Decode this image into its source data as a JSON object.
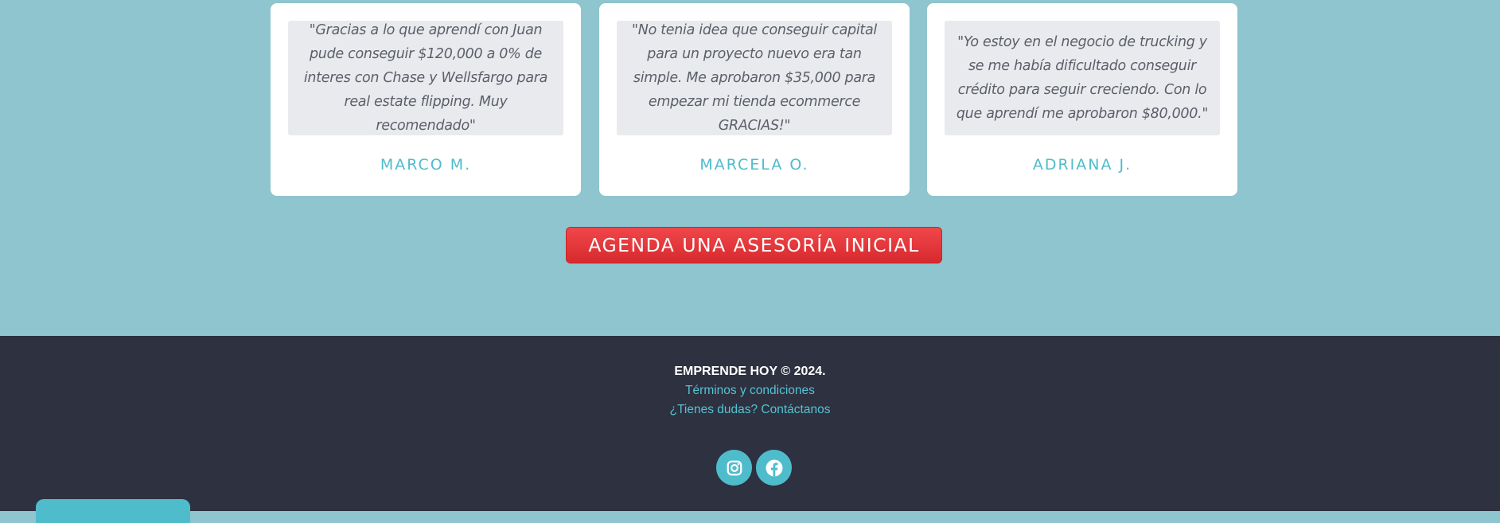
{
  "testimonials": [
    {
      "quote": "\"Gracias a lo que aprendí con Juan pude conseguir $120,000 a 0% de interes con Chase y Wellsfargo para real estate flipping. Muy recomendado\"",
      "author": "MARCO M."
    },
    {
      "quote": "\"No tenia idea que conseguir capital para un proyecto nuevo era tan simple. Me aprobaron $35,000 para empezar mi tienda ecommerce GRACIAS!\"",
      "author": "MARCELA O."
    },
    {
      "quote": "\"Yo estoy en el negocio de trucking y se me había dificultado conseguir crédito para seguir creciendo. Con lo que aprendí me aprobaron $80,000.\"",
      "author": "ADRIANA J."
    }
  ],
  "cta": {
    "label": "AGENDA UNA ASESORÍA INICIAL"
  },
  "footer": {
    "copyright": "EMPRENDE HOY © 2024.",
    "terms_link": "Términos y condiciones",
    "contact_link": "¿Tienes dudas? Contáctanos",
    "social": [
      "instagram-icon",
      "facebook-icon"
    ]
  },
  "colors": {
    "background": "#8ec5cf",
    "card": "#ffffff",
    "quote_box": "#e9eaee",
    "accent": "#4fbccc",
    "cta": "#e5383c",
    "footer": "#2d3140"
  }
}
